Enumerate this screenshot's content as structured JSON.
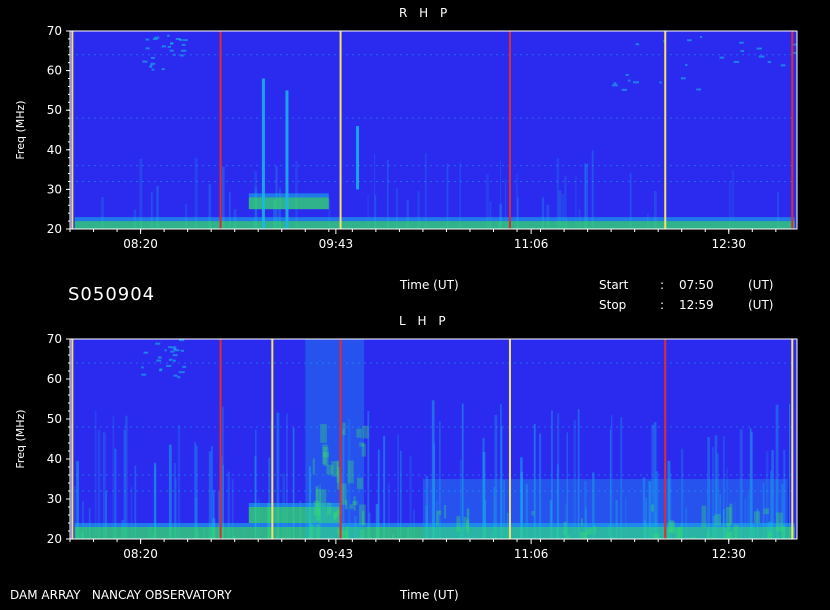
{
  "header": {
    "top_title": "R H P",
    "bottom_title": "L H P"
  },
  "info": {
    "station_id": "S050904",
    "time_axis_label": "Time (UT)",
    "start_label": "Start",
    "start_sep": ":",
    "start_value": "07:50",
    "start_unit": "(UT)",
    "stop_label": "Stop",
    "stop_sep": ":",
    "stop_value": "12:59",
    "stop_unit": "(UT)"
  },
  "footer": {
    "observatory": "DAM ARRAY   NANCAY OBSERVATORY",
    "time_axis_label": "Time (UT)"
  },
  "colors": {
    "background": "#2b2bf0",
    "noise_cyan": "#18b8e8",
    "band_green": "#33e26a",
    "marker_red": "#e32b2b",
    "marker_yellow": "#f5e06a",
    "axis": "#ffffff"
  },
  "chart_data": [
    {
      "type": "heatmap",
      "title": "R H P",
      "xlabel": "Time (UT)",
      "ylabel": "Freq (MHz)",
      "xlim": [
        "07:50",
        "12:59"
      ],
      "ylim": [
        20,
        70
      ],
      "x_ticks": [
        "08:20",
        "09:43",
        "11:06",
        "12:30"
      ],
      "y_ticks": [
        20,
        30,
        40,
        50,
        60,
        70
      ],
      "vertical_markers_ut": [
        "07:51",
        "08:54",
        "09:45",
        "10:57",
        "12:03",
        "12:57"
      ],
      "features": [
        {
          "kind": "band",
          "freq": [
            20,
            22
          ],
          "from": "07:52",
          "to": "12:58",
          "intensity": "high"
        },
        {
          "kind": "band",
          "freq": [
            25,
            28
          ],
          "from": "09:06",
          "to": "09:40",
          "intensity": "high"
        },
        {
          "kind": "burst",
          "freq": [
            20,
            58
          ],
          "at": "09:12"
        },
        {
          "kind": "burst",
          "freq": [
            20,
            55
          ],
          "at": "09:22"
        },
        {
          "kind": "burst",
          "freq": [
            30,
            46
          ],
          "at": "09:52"
        },
        {
          "kind": "patch",
          "freq": [
            60,
            70
          ],
          "from": "08:20",
          "to": "08:38"
        },
        {
          "kind": "patch",
          "freq": [
            55,
            70
          ],
          "from": "11:40",
          "to": "12:58"
        }
      ]
    },
    {
      "type": "heatmap",
      "title": "L H P",
      "xlabel": "Time (UT)",
      "ylabel": "Freq (MHz)",
      "xlim": [
        "07:50",
        "12:59"
      ],
      "ylim": [
        20,
        70
      ],
      "x_ticks": [
        "08:20",
        "09:43",
        "11:06",
        "12:30"
      ],
      "y_ticks": [
        20,
        30,
        40,
        50,
        60,
        70
      ],
      "vertical_markers_ut": [
        "07:51",
        "08:54",
        "09:16",
        "09:45",
        "10:57",
        "12:03",
        "12:57"
      ],
      "features": [
        {
          "kind": "band",
          "freq": [
            20,
            23
          ],
          "from": "07:52",
          "to": "12:58",
          "intensity": "high"
        },
        {
          "kind": "band",
          "freq": [
            24,
            28
          ],
          "from": "09:06",
          "to": "09:45",
          "intensity": "high"
        },
        {
          "kind": "region",
          "freq": [
            20,
            70
          ],
          "from": "09:30",
          "to": "09:55",
          "intensity": "medium"
        },
        {
          "kind": "region",
          "freq": [
            20,
            35
          ],
          "from": "10:20",
          "to": "12:55",
          "intensity": "medium"
        },
        {
          "kind": "patch",
          "freq": [
            60,
            70
          ],
          "from": "08:20",
          "to": "08:38"
        }
      ]
    }
  ]
}
